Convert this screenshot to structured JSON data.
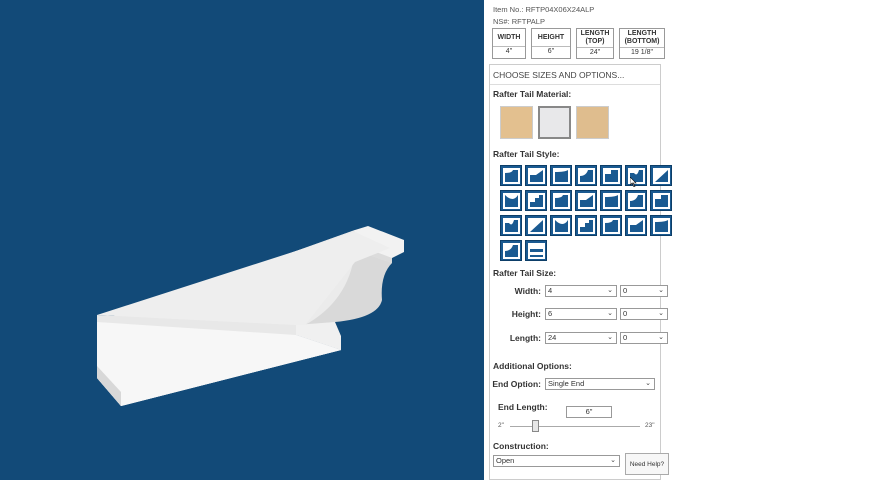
{
  "product": {
    "item_no": "Item No.: RFTP04X06X24ALP",
    "ns_no": "NS#: RFTPALP"
  },
  "dimensions": [
    {
      "label": "WIDTH",
      "value": "4\""
    },
    {
      "label": "HEIGHT",
      "value": "6\""
    },
    {
      "label": "LENGTH (TOP)",
      "value": "24\""
    },
    {
      "label": "LENGTH (BOTTOM)",
      "value": "19 1/8\""
    }
  ],
  "options": {
    "header": "CHOOSE SIZES AND OPTIONS...",
    "material_title": "Rafter Tail Material:",
    "materials": [
      {
        "name": "tan",
        "color": "#e3c08f"
      },
      {
        "name": "white",
        "color": "#e8e8ea",
        "selected": true
      },
      {
        "name": "light-tan",
        "color": "#dfbd8e"
      }
    ],
    "style_title": "Rafter Tail Style:",
    "style_rows": [
      7,
      7,
      7,
      2
    ],
    "size_title": "Rafter Tail Size:",
    "sizes": [
      {
        "label": "Width:",
        "value": "4",
        "fraction": "0"
      },
      {
        "label": "Height:",
        "value": "6",
        "fraction": "0"
      },
      {
        "label": "Length:",
        "value": "24",
        "fraction": "0"
      }
    ],
    "additional_title": "Additional Options:",
    "end_option_label": "End Option:",
    "end_option_value": "Single End",
    "end_length_label": "End Length:",
    "end_length_value": "6\"",
    "slider_min": "2\"",
    "slider_max": "23\"",
    "slider_fraction": 0.19,
    "construction_title": "Construction:",
    "construction_value": "Open",
    "help_label": "Need Help?"
  },
  "colors": {
    "viewport_bg": "#124a78",
    "style_button": "#1a5a91"
  }
}
